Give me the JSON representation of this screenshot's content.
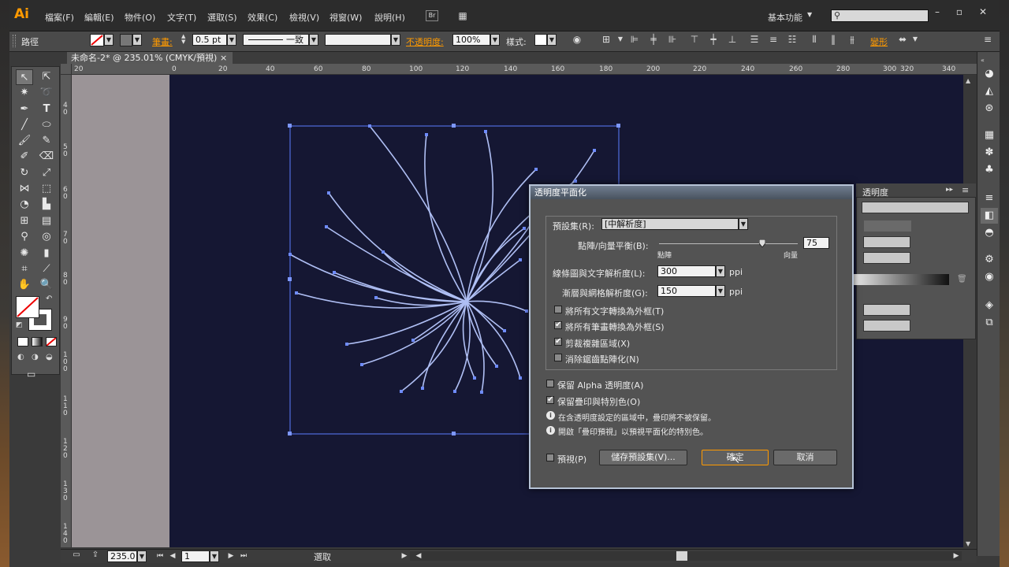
{
  "app": {
    "logo": "Ai",
    "menus": [
      "檔案(F)",
      "編輯(E)",
      "物件(O)",
      "文字(T)",
      "選取(S)",
      "效果(C)",
      "檢視(V)",
      "視窗(W)",
      "說明(H)"
    ],
    "workspace": "基本功能",
    "search_icon": "search-icon",
    "window_controls": [
      "minimize-icon",
      "maximize-icon",
      "close-icon"
    ]
  },
  "control_bar": {
    "object_type": "路徑",
    "stroke_label": "筆畫:",
    "stroke_weight": "0.5 pt",
    "stroke_profile": "一致",
    "opacity_label": "不透明度:",
    "opacity_value": "100%",
    "style_label": "樣式:",
    "transform_label": "變形"
  },
  "document": {
    "tab_title": "未命名-2* @ 235.01% (CMYK/預視)",
    "close": "×"
  },
  "rulers": {
    "top": [
      "20",
      "0",
      "20",
      "40",
      "60",
      "80",
      "100",
      "120",
      "140",
      "160",
      "180",
      "200",
      "220",
      "240",
      "260",
      "280",
      "300",
      "320",
      "340"
    ],
    "left": [
      "4\n0",
      "5\n0",
      "6\n0",
      "7\n0",
      "8\n0",
      "9\n0",
      "1\n0\n0",
      "1\n1\n0",
      "1\n2\n0",
      "1\n3\n0",
      "1\n4\n0"
    ]
  },
  "status_bar": {
    "zoom": "235.0",
    "page": "1",
    "tool_status": "選取"
  },
  "transparency_panel": {
    "title": "透明度"
  },
  "dialog": {
    "title": "透明度平面化",
    "preset_label": "預設集(R):",
    "preset_value": "[中解析度]",
    "balance_label": "點陣/向量平衡(B):",
    "balance_value": "75",
    "balance_level": 0.75,
    "balance_min": "點陣",
    "balance_max": "向量",
    "line_art_label": "線條圖與文字解析度(L):",
    "line_art_value": "300",
    "gradient_label": "漸層與網格解析度(G):",
    "gradient_value": "150",
    "unit": "ppi",
    "opt_text_outline": "將所有文字轉換為外框(T)",
    "opt_text_outline_checked": false,
    "opt_stroke_outline": "將所有筆畫轉換為外框(S)",
    "opt_stroke_outline_checked": true,
    "opt_clip_complex": "剪裁複雜區域(X)",
    "opt_clip_complex_checked": true,
    "opt_antialias": "消除鋸齒點陣化(N)",
    "opt_antialias_checked": false,
    "opt_alpha": "保留 Alpha 透明度(A)",
    "opt_alpha_checked": false,
    "opt_overprint": "保留疊印與特別色(O)",
    "opt_overprint_checked": true,
    "info1": "在含透明度設定的區域中，疊印將不被保留。",
    "info2": "開啟「疊印預視」以預視平面化的特別色。",
    "preview_label": "預視(P)",
    "preview_checked": false,
    "save_preset": "儲存預設集(V)...",
    "ok": "確定",
    "cancel": "取消"
  },
  "colors": {
    "accent": "#ff9a00",
    "artboard": "#151733",
    "selection": "#5b7cff"
  }
}
